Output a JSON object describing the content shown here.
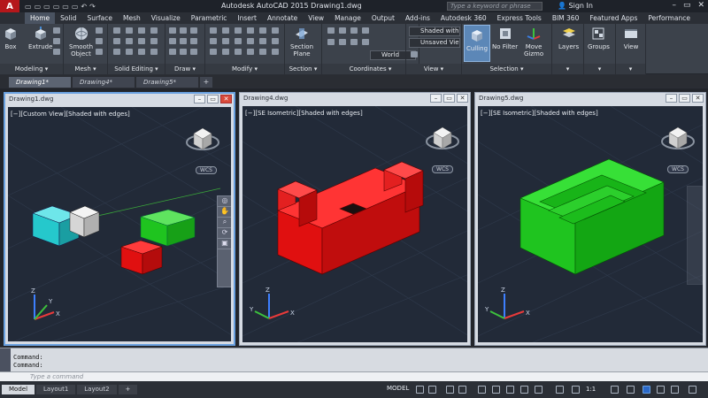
{
  "titlebar": {
    "logo": "A",
    "title": "Autodesk AutoCAD 2015   Drawing1.dwg",
    "search_placeholder": "Type a keyword or phrase",
    "signin": "Sign In",
    "qat": [
      "▭",
      "▭",
      "▭",
      "▭",
      "▭",
      "▭",
      "↶",
      "↷"
    ],
    "controls": [
      "–",
      "▭",
      "✕"
    ]
  },
  "ribbon_tabs": [
    "Home",
    "Solid",
    "Surface",
    "Mesh",
    "Visualize",
    "Parametric",
    "Insert",
    "Annotate",
    "View",
    "Manage",
    "Output",
    "Add-ins",
    "Autodesk 360",
    "Express Tools",
    "BIM 360",
    "Featured Apps",
    "Performance"
  ],
  "ribbon": {
    "box_label": "Box",
    "extrude_label": "Extrude",
    "smooth_label": "Smooth\nObject",
    "section_plane_label": "Section\nPlane",
    "culling_label": "Culling",
    "nofilter_label": "No Filter",
    "movegizmo_label": "Move\nGizmo",
    "layers_label": "Layers",
    "groups_label": "Groups",
    "view_label": "View",
    "dd_visual_style": "Shaded with e...",
    "dd_view": "Unsaved View",
    "dd_ucs": "World",
    "panels": [
      "Modeling",
      "Mesh",
      "Solid Editing",
      "Draw",
      "Modify",
      "Section",
      "Coordinates",
      "View",
      "Selection"
    ]
  },
  "doc_tabs": [
    "Drawing1*",
    "Drawing4*",
    "Drawing5*"
  ],
  "viewports": [
    {
      "title": "Drawing1.dwg",
      "label": "[−][Custom View][Shaded with edges]"
    },
    {
      "title": "Drawing4.dwg",
      "label": "[−][SE Isometric][Shaded with edges]"
    },
    {
      "title": "Drawing5.dwg",
      "label": "[−][SE Isometric][Shaded with edges]"
    }
  ],
  "wcs_label": "WCS",
  "command": {
    "line1": "Command:",
    "line2": "Command:",
    "placeholder": "Type a command"
  },
  "layout_tabs": [
    "Model",
    "Layout1",
    "Layout2"
  ],
  "status": {
    "model": "MODEL",
    "scale": "1:1"
  },
  "colors": {
    "red_solid": "#e01010",
    "green_solid": "#1fc41f",
    "cyan_solid": "#25c8cc",
    "accent": "#6aa1e0"
  }
}
